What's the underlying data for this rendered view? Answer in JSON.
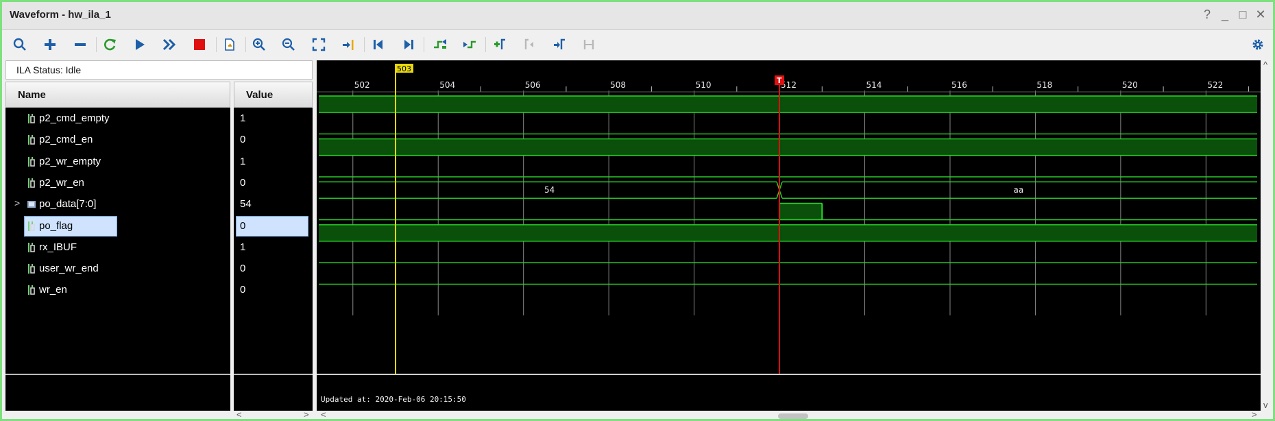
{
  "window": {
    "title": "Waveform - hw_ila_1"
  },
  "window_controls": {
    "help": "?",
    "minimize": "_",
    "maximize": "□",
    "close": "✕"
  },
  "toolbar": {
    "buttons": [
      {
        "name": "search-icon"
      },
      {
        "name": "add-icon"
      },
      {
        "name": "remove-icon"
      },
      {
        "name": "refresh-icon"
      },
      {
        "name": "run-trigger-icon"
      },
      {
        "name": "run-immediate-icon"
      },
      {
        "name": "stop-icon"
      },
      {
        "name": "export-icon"
      },
      {
        "name": "zoom-in-icon"
      },
      {
        "name": "zoom-out-icon"
      },
      {
        "name": "zoom-fit-icon"
      },
      {
        "name": "go-to-cursor-icon"
      },
      {
        "name": "go-to-start-icon"
      },
      {
        "name": "go-to-end-icon"
      },
      {
        "name": "previous-transition-icon"
      },
      {
        "name": "next-transition-icon"
      },
      {
        "name": "add-marker-icon"
      },
      {
        "name": "previous-marker-icon"
      },
      {
        "name": "next-marker-icon"
      },
      {
        "name": "swap-cursors-icon"
      }
    ],
    "settings": "gear-icon"
  },
  "ila_status": "ILA Status:  Idle",
  "columns": {
    "name": "Name",
    "value": "Value"
  },
  "signals": [
    {
      "name": "p2_cmd_empty",
      "value": "1",
      "type": "bit"
    },
    {
      "name": "p2_cmd_en",
      "value": "0",
      "type": "bit"
    },
    {
      "name": "p2_wr_empty",
      "value": "1",
      "type": "bit"
    },
    {
      "name": "p2_wr_en",
      "value": "0",
      "type": "bit"
    },
    {
      "name": "po_data[7:0]",
      "value": "54",
      "type": "bus"
    },
    {
      "name": "po_flag",
      "value": "0",
      "type": "bit",
      "selected": true
    },
    {
      "name": "rx_IBUF",
      "value": "1",
      "type": "bit"
    },
    {
      "name": "user_wr_end",
      "value": "0",
      "type": "bit"
    },
    {
      "name": "wr_en",
      "value": "0",
      "type": "bit"
    }
  ],
  "timeline": {
    "start": 501.2,
    "end": 523.2,
    "ticks": [
      "502",
      "504",
      "506",
      "508",
      "510",
      "512",
      "514",
      "516",
      "518",
      "520",
      "522"
    ],
    "cursor": {
      "label": "503",
      "at": 503.0,
      "color": "#e8d80c"
    },
    "trigger_marker": {
      "label": "T",
      "at": 512.0,
      "color": "#e01010"
    }
  },
  "waveforms": [
    {
      "signal": "p2_cmd_empty",
      "kind": "bit",
      "segments": [
        {
          "from": 501.2,
          "to": 523.2,
          "level": 1
        }
      ]
    },
    {
      "signal": "p2_cmd_en",
      "kind": "bit",
      "segments": [
        {
          "from": 501.2,
          "to": 523.2,
          "level": 0
        }
      ]
    },
    {
      "signal": "p2_wr_empty",
      "kind": "bit",
      "segments": [
        {
          "from": 501.2,
          "to": 523.2,
          "level": 1
        }
      ]
    },
    {
      "signal": "p2_wr_en",
      "kind": "bit",
      "segments": [
        {
          "from": 501.2,
          "to": 523.2,
          "level": 0
        }
      ]
    },
    {
      "signal": "po_data[7:0]",
      "kind": "bus",
      "segments": [
        {
          "from": 501.2,
          "to": 512.0,
          "value": "54"
        },
        {
          "from": 512.0,
          "to": 523.2,
          "value": "aa"
        }
      ]
    },
    {
      "signal": "po_flag",
      "kind": "bit",
      "segments": [
        {
          "from": 501.2,
          "to": 512.0,
          "level": 0
        },
        {
          "from": 512.0,
          "to": 513.0,
          "level": 1
        },
        {
          "from": 513.0,
          "to": 523.2,
          "level": 0
        }
      ]
    },
    {
      "signal": "rx_IBUF",
      "kind": "bit",
      "segments": [
        {
          "from": 501.2,
          "to": 523.2,
          "level": 1
        }
      ]
    },
    {
      "signal": "user_wr_end",
      "kind": "bit",
      "segments": [
        {
          "from": 501.2,
          "to": 523.2,
          "level": 0
        }
      ]
    },
    {
      "signal": "wr_en",
      "kind": "bit",
      "segments": [
        {
          "from": 501.2,
          "to": 523.2,
          "level": 0
        }
      ]
    }
  ],
  "status_footer": "Updated at: 2020-Feb-06 20:15:50",
  "colors": {
    "wave_high_fill": "#0a4f0a",
    "wave_line": "#29d829",
    "grid": "#8a8a8a",
    "background": "#000000"
  }
}
